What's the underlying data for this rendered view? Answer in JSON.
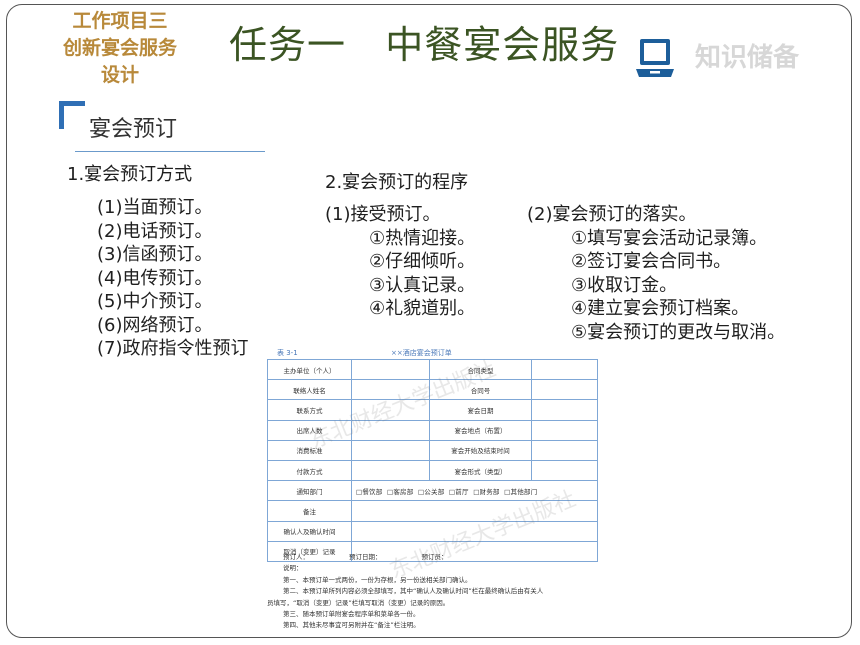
{
  "header": {
    "project_lines": [
      "工作项目三",
      "创新宴会服务",
      "设计"
    ],
    "task_title": "任务一   中餐宴会服务",
    "knowledge_label": "知识储备"
  },
  "section": {
    "title": "宴会预订"
  },
  "methods": {
    "heading": "1.宴会预订方式",
    "items": [
      "(1)当面预订。",
      "(2)电话预订。",
      "(3)信函预订。",
      "(4)电传预订。",
      "(5)中介预订。",
      "(6)网络预订。",
      "(7)政府指令性预订"
    ]
  },
  "procedure": {
    "heading": "2.宴会预订的程序",
    "receive": {
      "title": "(1)接受预订。",
      "steps": [
        "①热情迎接。",
        "②仔细倾听。",
        "③认真记录。",
        "④礼貌道别。"
      ]
    },
    "implement": {
      "title": "(2)宴会预订的落实。",
      "steps": [
        "①填写宴会活动记录簿。",
        "②签订宴会合同书。",
        "③收取订金。",
        "④建立宴会预订档案。",
        "⑤宴会预订的更改与取消。"
      ]
    }
  },
  "form": {
    "caption_left": "表 3-1",
    "caption_title": "××酒店宴会预订单",
    "rows": [
      [
        "主办单位（个人）",
        "",
        "合同类型",
        ""
      ],
      [
        "联络人姓名",
        "",
        "合同号",
        ""
      ],
      [
        "联系方式",
        "",
        "宴会日期",
        ""
      ],
      [
        "出席人数",
        "",
        "宴会地点（布置）",
        ""
      ],
      [
        "消费标准",
        "",
        "宴会开始及结束时间",
        ""
      ],
      [
        "付款方式",
        "",
        "宴会形式（类型）",
        ""
      ]
    ],
    "notify_label": "通知部门",
    "notify_options": "□餐饮部  □客房部  □公关部  □前厅  □财务部  □其他部门",
    "remarks_label": "备注",
    "confirm_label": "确认人及确认时间",
    "cancel_label": "取消（变更）记录",
    "signatures": [
      "预订人：",
      "预订日期：",
      "预订员："
    ],
    "notes_title": "说明：",
    "notes": [
      "第一、本预订单一式两份，一份为存根，另一份送相关部门确认。",
      "第二、本预订单所列内容必须全部填写，其中“确认人及确认时间”栏在最终确认后由有关人",
      "员填写，“取消（变更）记录”栏填写取消（变更）记录的原因。",
      "第三、随本预订单附宴会程序单和菜单各一份。",
      "第四、其他未尽事宜可另附并在“备注”栏注明。"
    ],
    "watermark": "东北财经大学出版社"
  }
}
